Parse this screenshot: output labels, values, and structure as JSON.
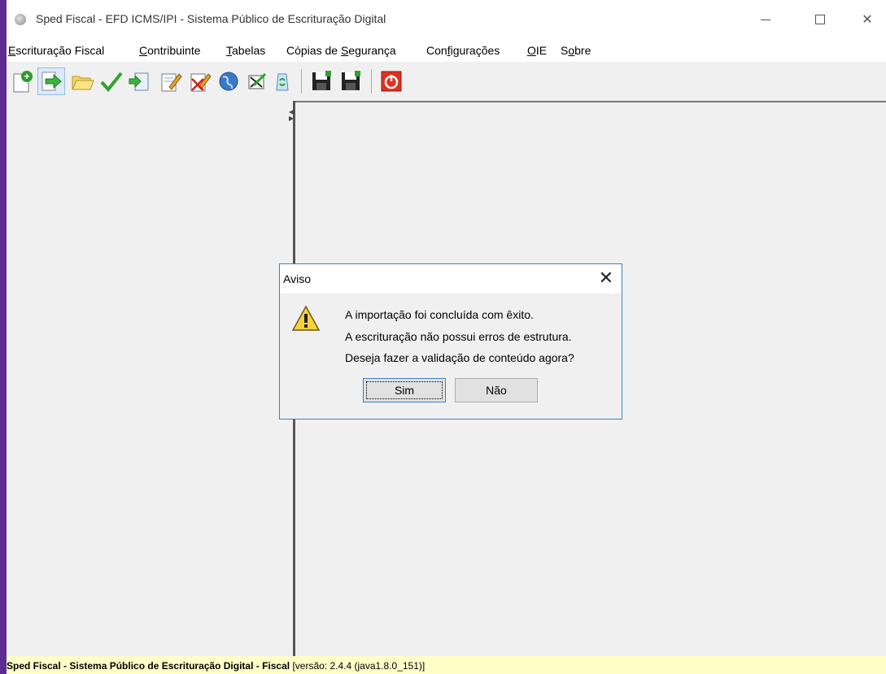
{
  "window": {
    "title": "Sped Fiscal - EFD ICMS/IPI - Sistema Público de Escrituração Digital"
  },
  "menu": [
    {
      "label": "Escrituração Fiscal",
      "accel": "E",
      "rest": "scrituração Fiscal"
    },
    {
      "label": "Contribuinte",
      "accel": "C",
      "rest": "ontribuinte"
    },
    {
      "label": "Tabelas",
      "accel": "T",
      "rest": "abelas"
    },
    {
      "label": "Cópias de Segurança",
      "pre": "Cópias de ",
      "accel": "S",
      "rest": "egurança"
    },
    {
      "label": "Configurações",
      "pre": "Con",
      "accel": "f",
      "rest": "igurações"
    },
    {
      "label": "OIE",
      "accel": "O",
      "rest": "IE"
    },
    {
      "label": "Sobre",
      "pre": "S",
      "accel": "o",
      "rest": "bre"
    }
  ],
  "toolbar": {
    "icons": [
      "new-file-icon",
      "import-arrow-icon",
      "open-folder-icon",
      "validate-check-icon",
      "import-doc-icon",
      "edit-doc-icon",
      "delete-doc-icon",
      "transmit-globe-icon",
      "signature-icon",
      "recycle-icon",
      "save-icon",
      "save-as-icon",
      "power-exit-icon"
    ]
  },
  "dialog": {
    "title": "Aviso",
    "messages": [
      "A importação foi concluída com êxito.",
      "A escrituração não possui erros de estrutura.",
      "Deseja fazer a validação de conteúdo agora?"
    ],
    "yes_label": "Sim",
    "no_label": "Não"
  },
  "statusbar": {
    "bold_text": "Sped Fiscal - Sistema Público de Escrituração Digital - Fiscal",
    "version_text": " [versão: 2.4.4 (java1.8.0_151)]"
  },
  "colors": {
    "desktop": "#5b2d91",
    "statusbar_bg": "#ffffc8",
    "dialog_border": "#3c7fc5"
  }
}
